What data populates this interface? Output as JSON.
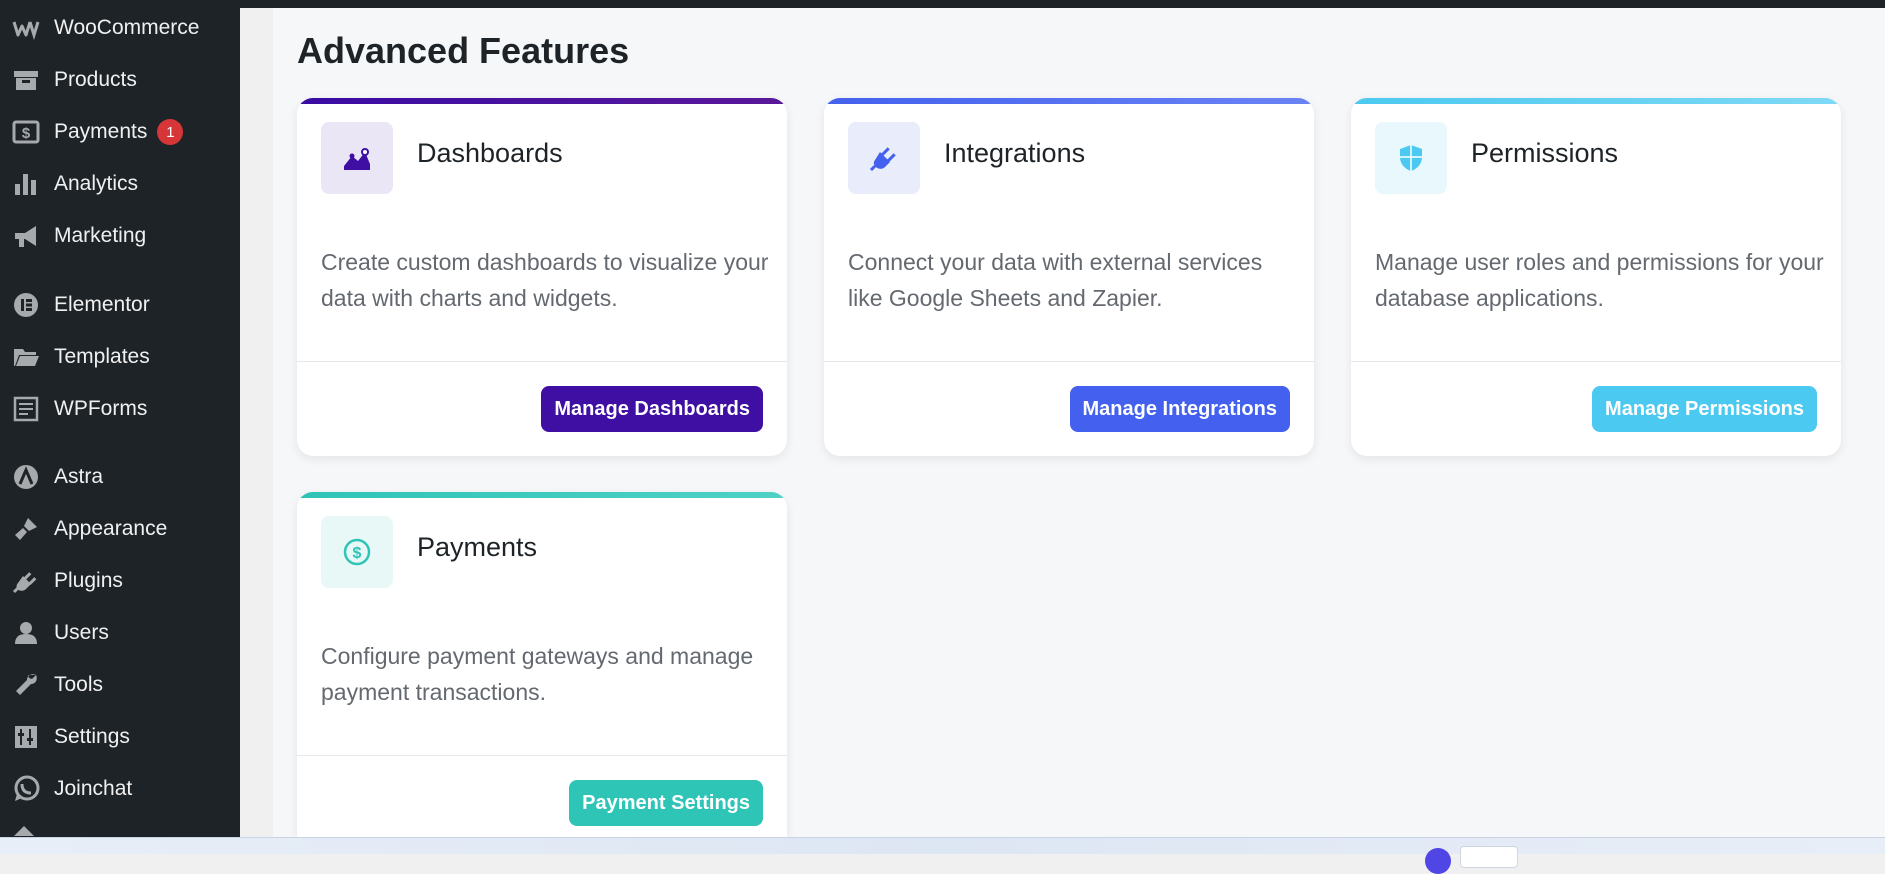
{
  "sidebar": {
    "items": [
      {
        "label": "WooCommerce",
        "icon": "woocommerce-icon"
      },
      {
        "label": "Products",
        "icon": "archive-icon"
      },
      {
        "label": "Payments",
        "icon": "dollar-icon",
        "badge": "1"
      },
      {
        "label": "Analytics",
        "icon": "bar-chart-icon"
      },
      {
        "label": "Marketing",
        "icon": "megaphone-icon"
      },
      {
        "label": "Elementor",
        "icon": "elementor-icon"
      },
      {
        "label": "Templates",
        "icon": "folder-icon"
      },
      {
        "label": "WPForms",
        "icon": "form-icon"
      },
      {
        "label": "Astra",
        "icon": "astra-icon"
      },
      {
        "label": "Appearance",
        "icon": "brush-icon"
      },
      {
        "label": "Plugins",
        "icon": "plug-icon"
      },
      {
        "label": "Users",
        "icon": "user-icon"
      },
      {
        "label": "Tools",
        "icon": "wrench-icon"
      },
      {
        "label": "Settings",
        "icon": "sliders-icon"
      },
      {
        "label": "Joinchat",
        "icon": "whatsapp-icon"
      }
    ]
  },
  "main": {
    "title": "Advanced Features",
    "cards": [
      {
        "title": "Dashboards",
        "description": "Create custom dashboards to visualize your data with charts and widgets.",
        "button": "Manage Dashboards",
        "icon": "chart-line-icon",
        "color": "#3f0fa3",
        "icon_bg": "#ebe6f5"
      },
      {
        "title": "Integrations",
        "description": "Connect your data with external services like Google Sheets and Zapier.",
        "button": "Manage Integrations",
        "icon": "plug-icon",
        "color": "#4361ee",
        "icon_bg": "#e9ecfb"
      },
      {
        "title": "Permissions",
        "description": "Manage user roles and permissions for your database applications.",
        "button": "Manage Permissions",
        "icon": "shield-icon",
        "color": "#4cc9f0",
        "icon_bg": "#e9f8fd"
      },
      {
        "title": "Payments",
        "description": "Configure payment gateways and manage payment transactions.",
        "button": "Payment Settings",
        "icon": "dollar-circle-icon",
        "color": "#2ec4b6",
        "icon_bg": "#e8f8f6"
      }
    ]
  }
}
